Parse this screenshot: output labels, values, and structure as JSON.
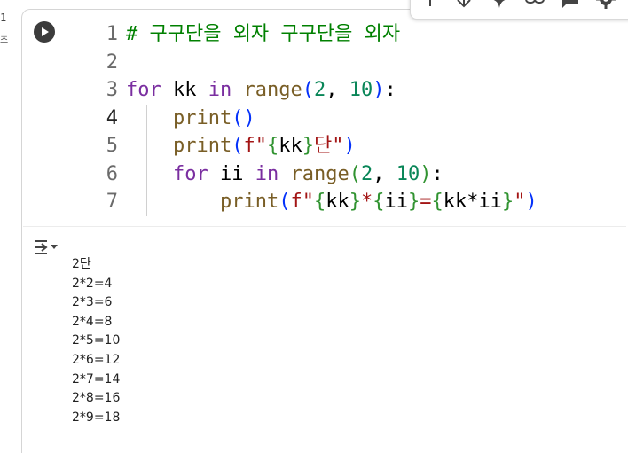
{
  "gutter": {
    "exec_count": "1",
    "exec_unit": "초"
  },
  "toolbar": {
    "items": [
      "move-up",
      "move-down",
      "gemini-sparkle",
      "copy-link",
      "comment",
      "settings"
    ]
  },
  "code": {
    "lines": [
      {
        "num": "1",
        "tokens": [
          {
            "t": "# 구구단을 외자 구구단을 외자",
            "c": "cmt"
          }
        ]
      },
      {
        "num": "2",
        "tokens": []
      },
      {
        "num": "3",
        "tokens": [
          {
            "t": "for",
            "c": "kw2"
          },
          {
            "t": " kk ",
            "c": "ident"
          },
          {
            "t": "in",
            "c": "kw2"
          },
          {
            "t": " ",
            "c": "ident"
          },
          {
            "t": "range",
            "c": "fn"
          },
          {
            "t": "(",
            "c": "p1"
          },
          {
            "t": "2",
            "c": "num"
          },
          {
            "t": ", ",
            "c": "ident"
          },
          {
            "t": "10",
            "c": "num"
          },
          {
            "t": ")",
            "c": "p1"
          },
          {
            "t": ":",
            "c": "ident"
          }
        ]
      },
      {
        "num": "4",
        "tokens": [
          {
            "t": "    ",
            "c": "ident"
          },
          {
            "t": "print",
            "c": "fn"
          },
          {
            "t": "()",
            "c": "p1"
          }
        ]
      },
      {
        "num": "5",
        "tokens": [
          {
            "t": "    ",
            "c": "ident"
          },
          {
            "t": "print",
            "c": "fn"
          },
          {
            "t": "(",
            "c": "p1"
          },
          {
            "t": "f\"",
            "c": "str"
          },
          {
            "t": "{",
            "c": "p2"
          },
          {
            "t": "kk",
            "c": "ident"
          },
          {
            "t": "}",
            "c": "p2"
          },
          {
            "t": "단\"",
            "c": "str"
          },
          {
            "t": ")",
            "c": "p1"
          }
        ]
      },
      {
        "num": "6",
        "tokens": [
          {
            "t": "    ",
            "c": "ident"
          },
          {
            "t": "for",
            "c": "kw2"
          },
          {
            "t": " ii ",
            "c": "ident"
          },
          {
            "t": "in",
            "c": "kw2"
          },
          {
            "t": " ",
            "c": "ident"
          },
          {
            "t": "range",
            "c": "fn"
          },
          {
            "t": "(",
            "c": "p2"
          },
          {
            "t": "2",
            "c": "num"
          },
          {
            "t": ", ",
            "c": "ident"
          },
          {
            "t": "10",
            "c": "num"
          },
          {
            "t": ")",
            "c": "p2"
          },
          {
            "t": ":",
            "c": "ident"
          }
        ]
      },
      {
        "num": "7",
        "tokens": [
          {
            "t": "        ",
            "c": "ident"
          },
          {
            "t": "print",
            "c": "fn"
          },
          {
            "t": "(",
            "c": "p1"
          },
          {
            "t": "f\"",
            "c": "str"
          },
          {
            "t": "{",
            "c": "p2"
          },
          {
            "t": "kk",
            "c": "ident"
          },
          {
            "t": "}",
            "c": "p2"
          },
          {
            "t": "*",
            "c": "str"
          },
          {
            "t": "{",
            "c": "p2"
          },
          {
            "t": "ii",
            "c": "ident"
          },
          {
            "t": "}",
            "c": "p2"
          },
          {
            "t": "=",
            "c": "str"
          },
          {
            "t": "{",
            "c": "p2"
          },
          {
            "t": "kk*ii",
            "c": "ident"
          },
          {
            "t": "}",
            "c": "p2"
          },
          {
            "t": "\"",
            "c": "str"
          },
          {
            "t": ")",
            "c": "p1"
          }
        ]
      }
    ]
  },
  "output": {
    "lines": [
      "2단",
      "2*2=4",
      "2*3=6",
      "2*4=8",
      "2*5=10",
      "2*6=12",
      "2*7=14",
      "2*8=16",
      "2*9=18"
    ]
  },
  "colors": {
    "keyword": "#7a2ea0",
    "function": "#795e26",
    "number": "#098658",
    "string": "#a31515",
    "comment": "#008000"
  }
}
